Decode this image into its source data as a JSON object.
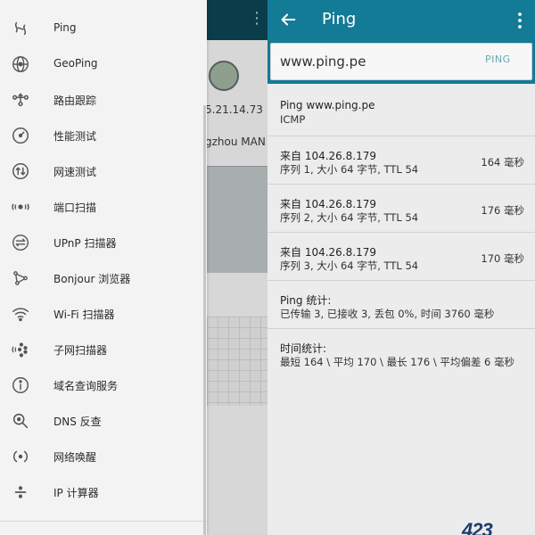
{
  "background_screen": {
    "ip_text": "5.21.14.73",
    "isp_text": "gzhou MAN"
  },
  "drawer": {
    "items": [
      {
        "label": "Ping",
        "icon": "ping-icon"
      },
      {
        "label": "GeoPing",
        "icon": "geoping-icon"
      },
      {
        "label": "路由跟踪",
        "icon": "traceroute-icon"
      },
      {
        "label": "性能测试",
        "icon": "speedometer-icon"
      },
      {
        "label": "网速测试",
        "icon": "updown-arrows-icon"
      },
      {
        "label": "端口扫描",
        "icon": "port-scan-icon"
      },
      {
        "label": "UPnP 扫描器",
        "icon": "upnp-icon"
      },
      {
        "label": "Bonjour 浏览器",
        "icon": "bonjour-icon"
      },
      {
        "label": "Wi-Fi 扫描器",
        "icon": "wifi-icon"
      },
      {
        "label": "子网扫描器",
        "icon": "subnet-icon"
      },
      {
        "label": "域名查询服务",
        "icon": "whois-icon"
      },
      {
        "label": "DNS 反查",
        "icon": "dns-search-icon"
      },
      {
        "label": "网络唤醒",
        "icon": "wake-on-lan-icon"
      },
      {
        "label": "IP 计算器",
        "icon": "calculator-icon"
      }
    ]
  },
  "appbar": {
    "title": "Ping",
    "back_icon": "arrow-left-icon",
    "overflow_icon": "more-vert-icon"
  },
  "input": {
    "host_value": "www.ping.pe",
    "action_label": "PING"
  },
  "results": {
    "header": {
      "title": "Ping www.ping.pe",
      "protocol": "ICMP"
    },
    "replies": [
      {
        "from": "来自 104.26.8.179",
        "detail": "序列 1, 大小 64 字节, TTL 54",
        "time": "164 毫秒"
      },
      {
        "from": "来自 104.26.8.179",
        "detail": "序列 2, 大小 64 字节, TTL 54",
        "time": "176 毫秒"
      },
      {
        "from": "来自 104.26.8.179",
        "detail": "序列 3, 大小 64 字节, TTL 54",
        "time": "170 毫秒"
      }
    ],
    "ping_stats": {
      "title": "Ping 统计:",
      "text": "已传输 3, 已接收 3, 丢包 0%, 时间 3760 毫秒"
    },
    "time_stats": {
      "title": "时间统计:",
      "text": "最短 164 \\ 平均 170 \\ 最长 176 \\ 平均偏差 6 毫秒"
    }
  },
  "colors": {
    "appbar": "#137b96",
    "drawer_bg": "#f3f3f3",
    "content_bg": "#ececec",
    "accent_text": "#6aa7b4"
  }
}
